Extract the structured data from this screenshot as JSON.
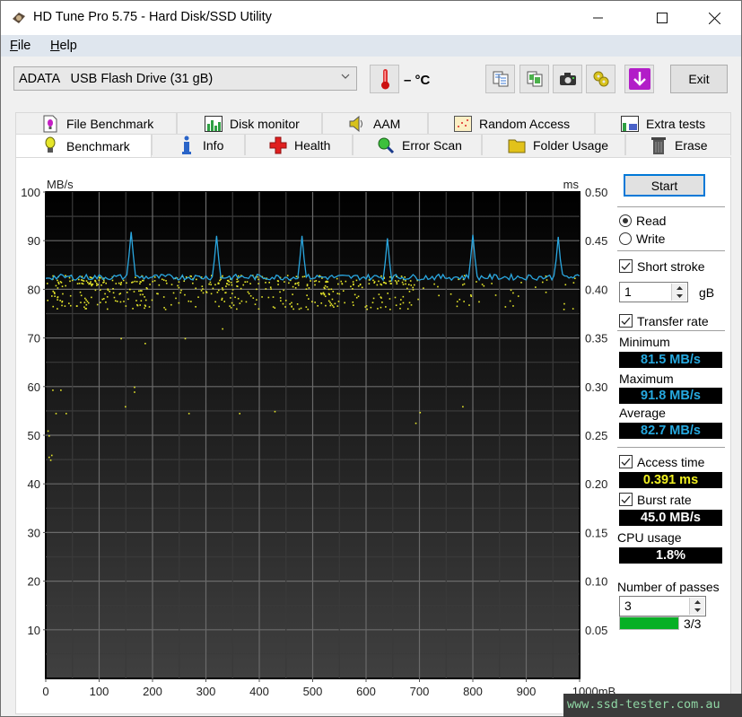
{
  "window": {
    "title": "HD Tune Pro 5.75 - Hard Disk/SSD Utility",
    "controls": [
      "minimize",
      "maximize",
      "close"
    ]
  },
  "menu": [
    {
      "label": "File",
      "mnemonic": "F",
      "rest": "ile"
    },
    {
      "label": "Help",
      "mnemonic": "H",
      "rest": "elp"
    }
  ],
  "toolbar": {
    "drive": "ADATA   USB Flash Drive (31 gB)",
    "temperature": "– °C",
    "icons": [
      "copy-text-icon",
      "copy-screenshot-icon",
      "camera-icon",
      "options-icon",
      "save-download-icon"
    ],
    "exit_label": "Exit"
  },
  "tabs": {
    "row1": [
      {
        "label": "File Benchmark",
        "icon": "file-benchmark-icon"
      },
      {
        "label": "Disk monitor",
        "icon": "disk-monitor-icon"
      },
      {
        "label": "AAM",
        "icon": "speaker-icon"
      },
      {
        "label": "Random Access",
        "icon": "random-access-icon"
      },
      {
        "label": "Extra tests",
        "icon": "extra-tests-icon"
      }
    ],
    "row2": [
      {
        "label": "Benchmark",
        "icon": "lightbulb-icon",
        "active": true
      },
      {
        "label": "Info",
        "icon": "info-icon"
      },
      {
        "label": "Health",
        "icon": "health-cross-icon"
      },
      {
        "label": "Error Scan",
        "icon": "magnifier-icon"
      },
      {
        "label": "Folder Usage",
        "icon": "folder-icon"
      },
      {
        "label": "Erase",
        "icon": "trash-icon"
      }
    ]
  },
  "side": {
    "start_label": "Start",
    "read_label": "Read",
    "write_label": "Write",
    "mode": "Read",
    "short_stroke_label": "Short stroke",
    "short_stroke_checked": true,
    "short_stroke_value": "1",
    "short_stroke_unit": "gB",
    "transfer_rate_label": "Transfer rate",
    "transfer_rate_checked": true,
    "minimum_label": "Minimum",
    "minimum_value": "81.5 MB/s",
    "maximum_label": "Maximum",
    "maximum_value": "91.8 MB/s",
    "average_label": "Average",
    "average_value": "82.7 MB/s",
    "access_time_label": "Access time",
    "access_time_checked": true,
    "access_time_value": "0.391 ms",
    "burst_rate_label": "Burst rate",
    "burst_rate_checked": true,
    "burst_rate_value": "45.0 MB/s",
    "cpu_label": "CPU usage",
    "cpu_value": "1.8%",
    "passes_label": "Number of passes",
    "passes_value": "3",
    "progress_text": "3/3",
    "progress_fraction": 1.0
  },
  "colors": {
    "transfer_line": "#2aa7e0",
    "access_points": "#e6e62a",
    "min_max_avg_text": "#26a9e0",
    "access_text": "#f0f020",
    "white_text": "#ffffff",
    "progress_green": "#06b025"
  },
  "chart_data": {
    "type": "line",
    "title": "",
    "xlabel": "mB",
    "ylabel_left": "MB/s",
    "ylabel_right": "ms",
    "xlim": [
      0,
      1000
    ],
    "ylim_left": [
      0,
      100
    ],
    "ylim_right": [
      0,
      0.5
    ],
    "x_ticks": [
      "0",
      "100",
      "200",
      "300",
      "400",
      "500",
      "600",
      "700",
      "800",
      "900",
      "1000mB"
    ],
    "y_ticks_left": [
      "10",
      "20",
      "30",
      "40",
      "50",
      "60",
      "70",
      "80",
      "90",
      "100"
    ],
    "y_ticks_right": [
      "0.05",
      "0.10",
      "0.15",
      "0.20",
      "0.25",
      "0.30",
      "0.35",
      "0.40",
      "0.45",
      "0.50"
    ],
    "grid": true,
    "series": [
      {
        "name": "Transfer rate (MB/s)",
        "kind": "line",
        "baseline": 82.5,
        "spikes": [
          {
            "x": 160,
            "y": 91.8
          },
          {
            "x": 320,
            "y": 91.0
          },
          {
            "x": 480,
            "y": 91.0
          },
          {
            "x": 640,
            "y": 90.5
          },
          {
            "x": 800,
            "y": 91.2
          },
          {
            "x": 960,
            "y": 90.8
          }
        ]
      },
      {
        "name": "Access time (ms)",
        "kind": "scatter",
        "main_band_ms": [
          0.38,
          0.415
        ],
        "upper_band_ms": [
          0.405,
          0.415
        ],
        "outliers": [
          {
            "x": 5,
            "y": 0.228
          },
          {
            "x": 8,
            "y": 0.225
          },
          {
            "x": 10,
            "y": 0.23
          },
          {
            "x": 3,
            "y": 0.255
          },
          {
            "x": 5,
            "y": 0.25
          },
          {
            "x": 12,
            "y": 0.297
          },
          {
            "x": 27,
            "y": 0.297
          },
          {
            "x": 18,
            "y": 0.273
          },
          {
            "x": 37,
            "y": 0.273
          },
          {
            "x": 148,
            "y": 0.28
          },
          {
            "x": 165,
            "y": 0.3
          },
          {
            "x": 165,
            "y": 0.295
          },
          {
            "x": 267,
            "y": 0.273
          },
          {
            "x": 362,
            "y": 0.273
          },
          {
            "x": 428,
            "y": 0.275
          },
          {
            "x": 692,
            "y": 0.263
          },
          {
            "x": 700,
            "y": 0.274
          },
          {
            "x": 780,
            "y": 0.28
          },
          {
            "x": 140,
            "y": 0.35
          },
          {
            "x": 185,
            "y": 0.345
          },
          {
            "x": 260,
            "y": 0.35
          },
          {
            "x": 330,
            "y": 0.36
          }
        ]
      }
    ]
  },
  "watermark": "www.ssd-tester.com.au"
}
